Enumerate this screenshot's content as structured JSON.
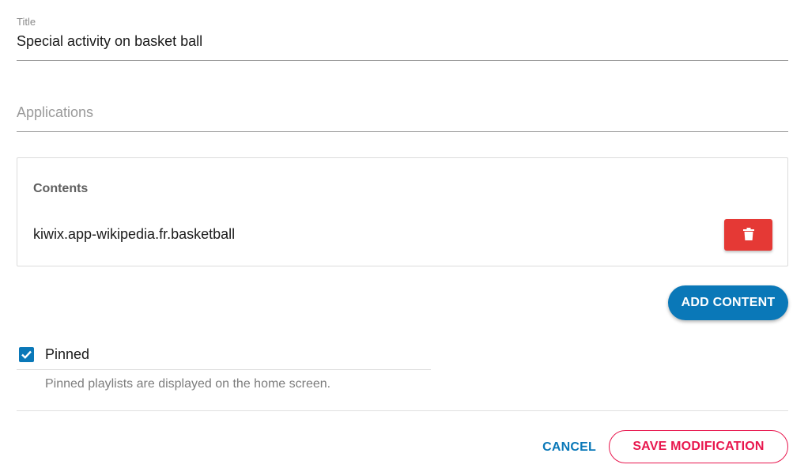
{
  "form": {
    "title_label": "Title",
    "title_value": "Special activity on basket ball",
    "applications_placeholder": "Applications",
    "applications_value": ""
  },
  "contents": {
    "heading": "Contents",
    "items": [
      {
        "label": "kiwix.app-wikipedia.fr.basketball",
        "delete_icon": "trash-icon"
      }
    ],
    "add_label": "ADD CONTENT"
  },
  "pinned": {
    "label": "Pinned",
    "checked": true,
    "help_text": "Pinned playlists are displayed on the home screen."
  },
  "actions": {
    "cancel_label": "CANCEL",
    "save_label": "SAVE MODIFICATION"
  },
  "colors": {
    "primary": "#0a78b8",
    "danger": "#e53935",
    "accent": "#e8174e"
  }
}
